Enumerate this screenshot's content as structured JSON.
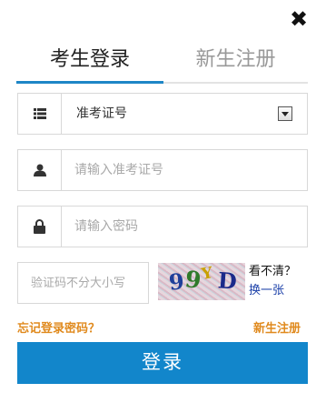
{
  "close": {
    "glyph": "✖"
  },
  "tabs": [
    {
      "label": "考生登录",
      "active": true
    },
    {
      "label": "新生注册",
      "active": false
    }
  ],
  "form": {
    "id_type": {
      "value": "准考证号"
    },
    "account": {
      "placeholder": "请输入准考证号"
    },
    "password": {
      "placeholder": "请输入密码"
    },
    "captcha": {
      "placeholder": "验证码不分大小写",
      "image_text": "99YD"
    }
  },
  "captcha_tip": "看不清？",
  "captcha_refresh": "换一张",
  "links": {
    "forgot": "忘记登录密码？",
    "register": "新生注册"
  },
  "login_button": "登录",
  "colors": {
    "accent": "#1286cb",
    "link_orange": "#e08a1e",
    "refresh_blue": "#1a3fa8"
  }
}
